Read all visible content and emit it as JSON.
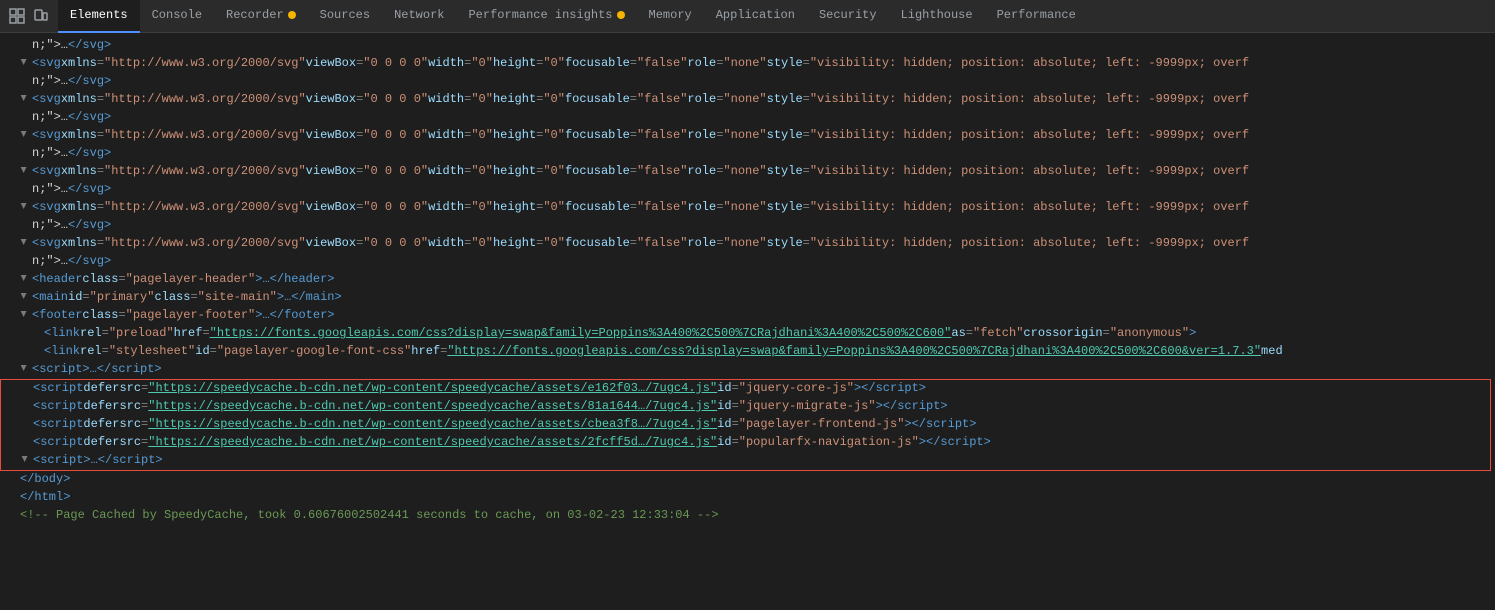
{
  "tabs": [
    {
      "id": "tab-icons",
      "type": "icons"
    },
    {
      "id": "elements",
      "label": "Elements",
      "active": true
    },
    {
      "id": "console",
      "label": "Console",
      "active": false
    },
    {
      "id": "recorder",
      "label": "Recorder",
      "active": false,
      "badge": true
    },
    {
      "id": "sources",
      "label": "Sources",
      "active": false
    },
    {
      "id": "network",
      "label": "Network",
      "active": false
    },
    {
      "id": "performance-insights",
      "label": "Performance insights",
      "active": false,
      "badge": true
    },
    {
      "id": "memory",
      "label": "Memory",
      "active": false
    },
    {
      "id": "application",
      "label": "Application",
      "active": false
    },
    {
      "id": "security",
      "label": "Security",
      "active": false
    },
    {
      "id": "lighthouse",
      "label": "Lighthouse",
      "active": false
    },
    {
      "id": "performance",
      "label": "Performance",
      "active": false
    }
  ],
  "lines": [
    {
      "indent": 1,
      "arrow": "none",
      "content": "n;\">…</svg>"
    },
    {
      "indent": 1,
      "arrow": "collapsed",
      "content": "svg_xmlns_1"
    },
    {
      "indent": 1,
      "arrow": "none",
      "content": "n;\">…</svg>"
    },
    {
      "indent": 1,
      "arrow": "collapsed",
      "content": "svg_xmlns_2"
    },
    {
      "indent": 1,
      "arrow": "none",
      "content": "n;\">…</svg>"
    },
    {
      "indent": 1,
      "arrow": "collapsed",
      "content": "svg_xmlns_3"
    },
    {
      "indent": 1,
      "arrow": "none",
      "content": "n;\">…</svg>"
    },
    {
      "indent": 1,
      "arrow": "collapsed",
      "content": "svg_xmlns_4"
    },
    {
      "indent": 1,
      "arrow": "none",
      "content": "n;\">…</svg>"
    },
    {
      "indent": 1,
      "arrow": "collapsed",
      "content": "svg_xmlns_5"
    },
    {
      "indent": 1,
      "arrow": "none",
      "content": "n;\">…</svg>"
    },
    {
      "indent": 1,
      "arrow": "collapsed",
      "content": "svg_xmlns_6"
    },
    {
      "indent": 1,
      "arrow": "none",
      "content": "n;\">…</svg>"
    },
    {
      "indent": 1,
      "arrow": "collapsed",
      "content": "header"
    },
    {
      "indent": 1,
      "arrow": "collapsed",
      "content": "main"
    },
    {
      "indent": 1,
      "arrow": "collapsed",
      "content": "footer"
    },
    {
      "indent": 2,
      "arrow": "none",
      "content": "link_preload"
    },
    {
      "indent": 2,
      "arrow": "none",
      "content": "link_stylesheet"
    },
    {
      "indent": 1,
      "arrow": "none",
      "content": "script_inline"
    },
    {
      "indent": 1,
      "arrow": "none",
      "content": "script_jquery_core",
      "highlighted": true,
      "htype": "top"
    },
    {
      "indent": 1,
      "arrow": "none",
      "content": "script_jquery_migrate",
      "highlighted": true,
      "htype": "mid"
    },
    {
      "indent": 1,
      "arrow": "none",
      "content": "script_pagelayer_frontend",
      "highlighted": true,
      "htype": "mid"
    },
    {
      "indent": 1,
      "arrow": "none",
      "content": "script_popularfx_navigation",
      "highlighted": true,
      "htype": "mid"
    },
    {
      "indent": 1,
      "arrow": "none",
      "content": "script_inline_close",
      "highlighted": true,
      "htype": "bot"
    },
    {
      "indent": 0,
      "arrow": "none",
      "content": "body_close"
    },
    {
      "indent": 0,
      "arrow": "none",
      "content": "html_close"
    },
    {
      "indent": 0,
      "arrow": "none",
      "content": "comment_cache"
    }
  ],
  "line_contents": {
    "svg_xmlns_1": {
      "parts": [
        {
          "type": "tag",
          "text": "<svg"
        },
        {
          "type": "attr-name",
          "text": " xmlns"
        },
        {
          "type": "punctuation",
          "text": "="
        },
        {
          "type": "attr-value",
          "text": "\"http://www.w3.org/2000/svg\""
        },
        {
          "type": "attr-name",
          "text": " viewBox"
        },
        {
          "type": "punctuation",
          "text": "="
        },
        {
          "type": "attr-value",
          "text": "\"0 0 0 0\""
        },
        {
          "type": "attr-name",
          "text": " width"
        },
        {
          "type": "punctuation",
          "text": "="
        },
        {
          "type": "attr-value",
          "text": "\"0\""
        },
        {
          "type": "attr-name",
          "text": " height"
        },
        {
          "type": "punctuation",
          "text": "="
        },
        {
          "type": "attr-value",
          "text": "\"0\""
        },
        {
          "type": "attr-name",
          "text": " focusable"
        },
        {
          "type": "punctuation",
          "text": "="
        },
        {
          "type": "attr-value",
          "text": "\"false\""
        },
        {
          "type": "attr-name",
          "text": " role"
        },
        {
          "type": "punctuation",
          "text": "="
        },
        {
          "type": "attr-value",
          "text": "\"none\""
        },
        {
          "type": "attr-name",
          "text": " style"
        },
        {
          "type": "punctuation",
          "text": "="
        },
        {
          "type": "attr-value",
          "text": "\"visibility: hidden; position: absolute; left: -9999px; overf"
        },
        {
          "type": "text",
          "text": ""
        }
      ]
    }
  },
  "colors": {
    "bg": "#1e1e1e",
    "tab_bg": "#2b2b2b",
    "active_tab_bg": "#1e1e1e",
    "active_tab_border": "#4d90fe",
    "highlight_border": "#e74c3c",
    "tag_color": "#569cd6",
    "attr_name_color": "#9cdcfe",
    "attr_value_color": "#ce9178",
    "link_color": "#4ec9b0",
    "comment_color": "#6a9955"
  }
}
